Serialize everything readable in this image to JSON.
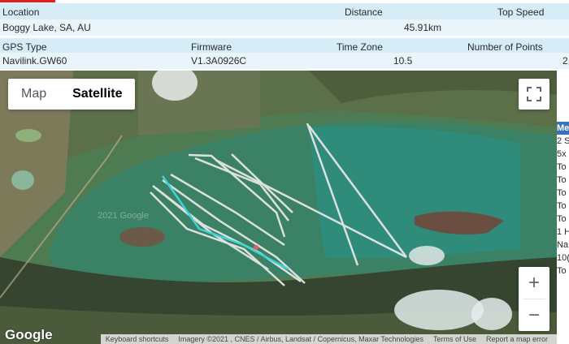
{
  "table": {
    "headers1": [
      "Location",
      "Distance",
      "Top Speed"
    ],
    "values1": [
      "Boggy Lake, SA, AU",
      "45.91km"
    ],
    "headers2": [
      "GPS Type",
      "Firmware",
      "Time Zone",
      "Number of Points"
    ],
    "values2": [
      "Navilink.GW60",
      "V1.3A0926C",
      "10.5",
      "2"
    ]
  },
  "map": {
    "map_label": "Map",
    "satellite_label": "Satellite",
    "selected_type": "Satellite",
    "zoom_in": "+",
    "zoom_out": "−",
    "google": "Google",
    "watermark": "2021 Google",
    "attribution": [
      "Keyboard shortcuts",
      "Imagery ©2021 , CNES / Airbus, Landsat / Copernicus, Maxar Technologies",
      "Terms of Use",
      "Report a map error"
    ],
    "icons": [
      "fullscreen-icon"
    ],
    "track_colors": {
      "main": "#e6e6e6",
      "highlight": "#3fd3d6",
      "marker": "#e85a5a"
    }
  },
  "side_panel": {
    "items": [
      "Me",
      "2 S",
      "5x",
      "To",
      "To",
      "To",
      "To",
      "To",
      "1 H",
      "Na",
      "10(",
      "To"
    ]
  }
}
